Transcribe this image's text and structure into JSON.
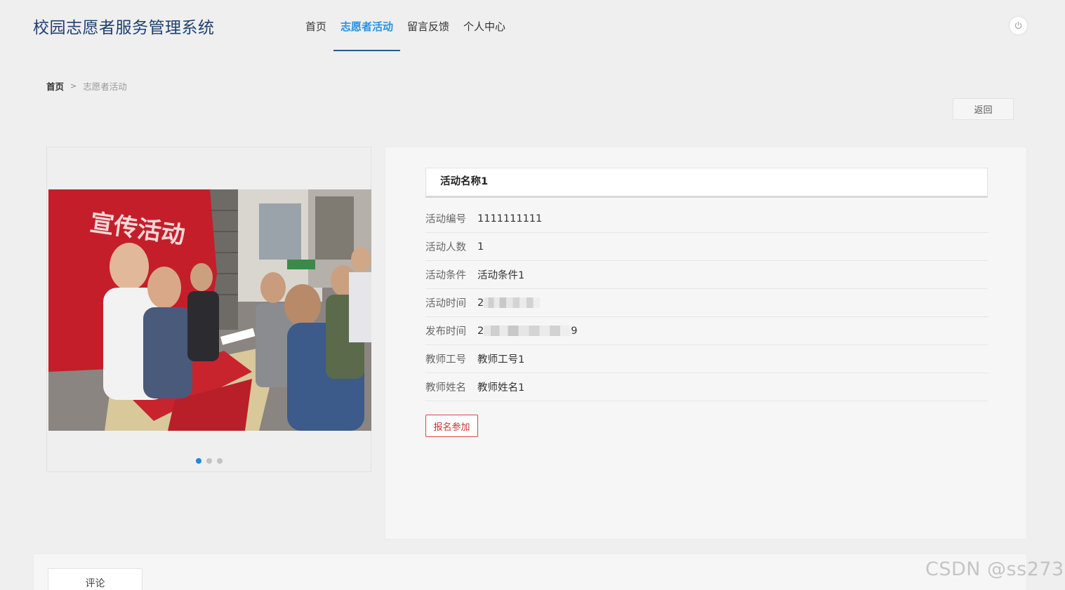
{
  "header": {
    "logo": "校园志愿者服务管理系统",
    "nav": [
      {
        "label": "首页",
        "active": false
      },
      {
        "label": "志愿者活动",
        "active": true
      },
      {
        "label": "留言反馈",
        "active": false
      },
      {
        "label": "个人中心",
        "active": false
      }
    ],
    "power_icon": "power-icon"
  },
  "breadcrumb": {
    "home": "首页",
    "separator": ">",
    "current": "志愿者活动"
  },
  "back_label": "返回",
  "carousel": {
    "slide_count": 3,
    "active_index": 0,
    "banner_text": "宣传活动"
  },
  "detail": {
    "title": "活动名称1",
    "rows": [
      {
        "label": "活动编号",
        "value": "1111111111"
      },
      {
        "label": "活动人数",
        "value": "1"
      },
      {
        "label": "活动条件",
        "value": "活动条件1"
      },
      {
        "label": "活动时间",
        "value": "2",
        "suffix": ""
      },
      {
        "label": "发布时间",
        "value": "2",
        "suffix": "9"
      },
      {
        "label": "教师工号",
        "value": "教师工号1"
      },
      {
        "label": "教师姓名",
        "value": "教师姓名1"
      }
    ],
    "join_label": "报名参加"
  },
  "comment_tab": "评论",
  "watermark": "CSDN @ss273",
  "colors": {
    "accent": "#2a93e0",
    "logo": "#1f3f6e",
    "nav_underline": "#2a5891",
    "join_border": "#dd4444",
    "dot_active": "#1e88e5"
  }
}
